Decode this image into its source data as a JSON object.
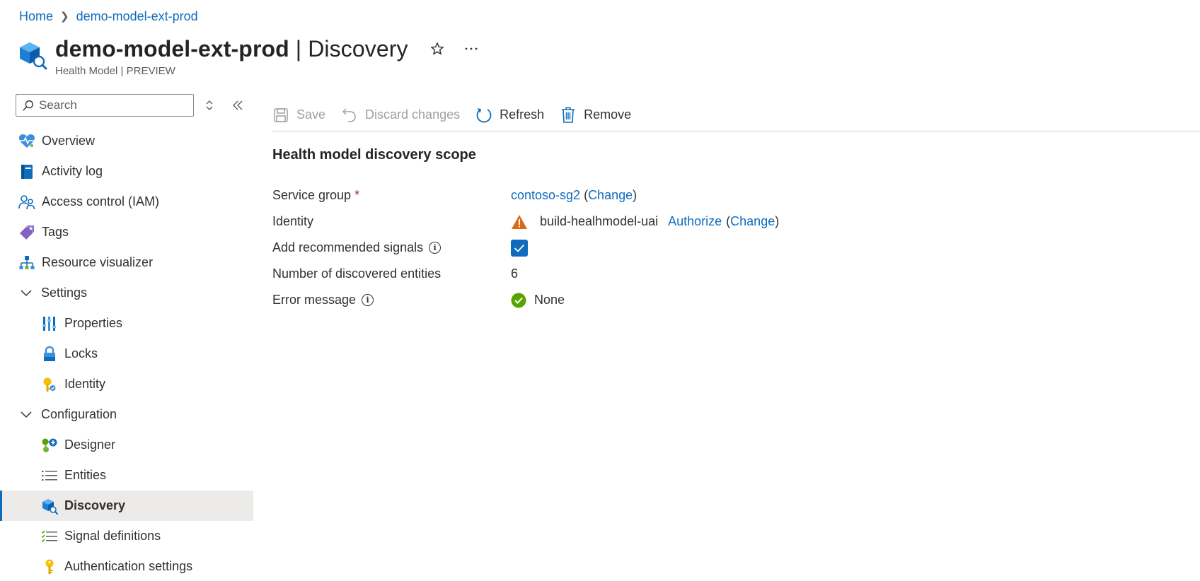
{
  "breadcrumb": {
    "home": "Home",
    "resource": "demo-model-ext-prod"
  },
  "header": {
    "resource_name": "demo-model-ext-prod",
    "separator": " | ",
    "page_name": "Discovery",
    "subtitle": "Health Model | PREVIEW",
    "favorite_icon": "star-icon",
    "more_icon": "more-icon"
  },
  "sidebar": {
    "search_placeholder": "Search",
    "items": [
      {
        "label": "Overview",
        "icon": "heart-pulse-icon"
      },
      {
        "label": "Activity log",
        "icon": "activity-log-icon"
      },
      {
        "label": "Access control (IAM)",
        "icon": "people-icon"
      },
      {
        "label": "Tags",
        "icon": "tag-icon"
      },
      {
        "label": "Resource visualizer",
        "icon": "hierarchy-icon"
      }
    ],
    "settings": {
      "label": "Settings",
      "items": [
        {
          "label": "Properties",
          "icon": "properties-icon"
        },
        {
          "label": "Locks",
          "icon": "lock-icon"
        },
        {
          "label": "Identity",
          "icon": "identity-key-icon"
        }
      ]
    },
    "configuration": {
      "label": "Configuration",
      "items": [
        {
          "label": "Designer",
          "icon": "designer-icon"
        },
        {
          "label": "Entities",
          "icon": "list-icon"
        },
        {
          "label": "Discovery",
          "icon": "discovery-icon",
          "active": true
        },
        {
          "label": "Signal definitions",
          "icon": "checklist-icon"
        },
        {
          "label": "Authentication settings",
          "icon": "key-icon"
        }
      ]
    }
  },
  "toolbar": {
    "save": "Save",
    "discard": "Discard changes",
    "refresh": "Refresh",
    "remove": "Remove"
  },
  "main": {
    "section_title": "Health model discovery scope",
    "service_group": {
      "label": "Service group",
      "required_mark": "*",
      "value": "contoso-sg2",
      "change": "Change",
      "open_paren": "(",
      "close_paren": ")"
    },
    "identity": {
      "label": "Identity",
      "value": "build-healhmodel-uai",
      "authorize": "Authorize",
      "change": "Change",
      "open_paren": "(",
      "close_paren": ")"
    },
    "recommended_signals": {
      "label": "Add recommended signals",
      "checked": true
    },
    "discovered_entities": {
      "label": "Number of discovered entities",
      "value": "6"
    },
    "error_message": {
      "label": "Error message",
      "value": "None"
    }
  },
  "colors": {
    "accent": "#0f6cbd",
    "warning": "#d86b1a",
    "success": "#57a300",
    "active_bg": "#edebe9"
  }
}
